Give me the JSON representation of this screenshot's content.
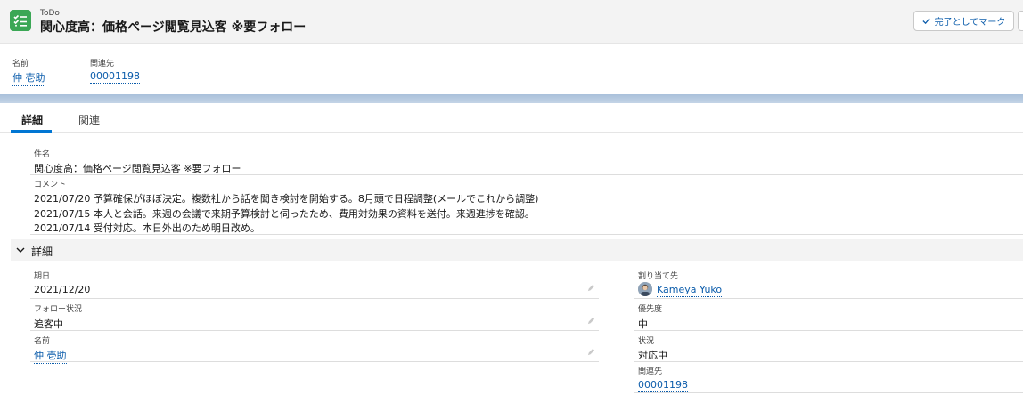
{
  "header": {
    "object_label": "ToDo",
    "title": "関心度高：価格ページ閲覧見込客 ※要フォロー",
    "mark_complete_label": "完了としてマーク",
    "highlights": [
      {
        "label": "名前",
        "value": "仲 壱助"
      },
      {
        "label": "関連先",
        "value": "00001198"
      }
    ]
  },
  "tabs": [
    {
      "label": "詳細",
      "active": true
    },
    {
      "label": "関連",
      "active": false
    }
  ],
  "subject": {
    "label": "件名",
    "value": "関心度高：価格ページ閲覧見込客 ※要フォロー"
  },
  "comment": {
    "label": "コメント",
    "lines": [
      "2021/07/20 予算確保がほぼ決定。複数社から話を聞き検討を開始する。8月頭で日程調整(メールでこれから調整)",
      "2021/07/15 本人と会話。来週の会議で来期予算検討と伺ったため、費用対効果の資料を送付。来週進捗を確認。",
      "2021/07/14 受付対応。本日外出のため明日改め。"
    ]
  },
  "section": {
    "title": "詳細"
  },
  "left_fields": [
    {
      "label": "期日",
      "value": "2021/12/20"
    },
    {
      "label": "フォロー状況",
      "value": "追客中"
    },
    {
      "label": "名前",
      "value": "仲 壱助"
    }
  ],
  "right_fields": [
    {
      "label": "割り当て先",
      "value": "Kameya Yuko"
    },
    {
      "label": "優先度",
      "value": "中"
    },
    {
      "label": "状況",
      "value": "対応中"
    },
    {
      "label": "関連先",
      "value": "00001198"
    }
  ],
  "colors": {
    "brand": "#0176d3",
    "link": "#0b5cab",
    "todo_icon": "#3ba755"
  }
}
